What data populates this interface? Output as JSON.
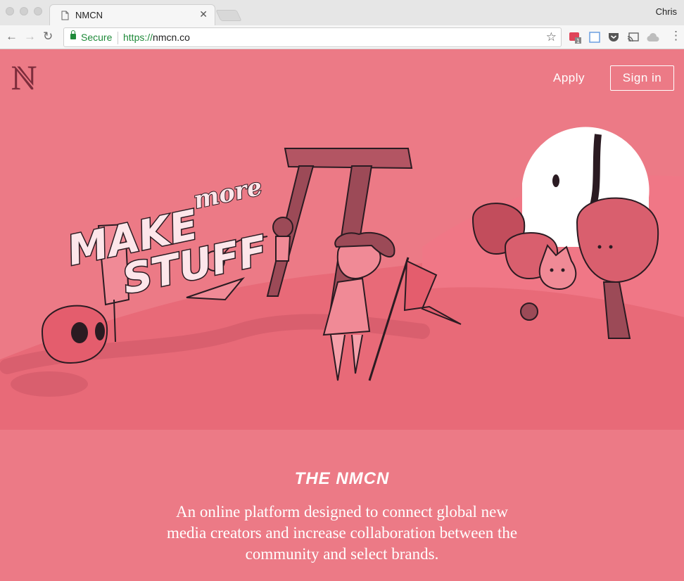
{
  "browser": {
    "tab_title": "NMCN",
    "profile_name": "Chris",
    "secure_label": "Secure",
    "url_scheme": "https://",
    "url_host": "nmcn.co",
    "extension_badge": "1"
  },
  "nav": {
    "logo_letter": "N",
    "apply_label": "Apply",
    "signin_label": "Sign in"
  },
  "hero": {
    "art_make": "MAKE",
    "art_more": "more",
    "art_stuff": "STUFF"
  },
  "about": {
    "heading": "THE NMCN",
    "description": "An online platform designed to connect global new media creators and increase collaboration between the community and select brands."
  },
  "colors": {
    "background": "#ec7a86",
    "secure_green": "#1f8a3a",
    "dark_outline": "#2b1b22"
  },
  "icons": [
    "document-icon",
    "close-icon",
    "back-arrow-icon",
    "forward-arrow-icon",
    "reload-icon",
    "lock-icon",
    "star-icon",
    "extension-icon",
    "pocket-icon",
    "cast-icon",
    "drive-icon",
    "menu-icon"
  ]
}
